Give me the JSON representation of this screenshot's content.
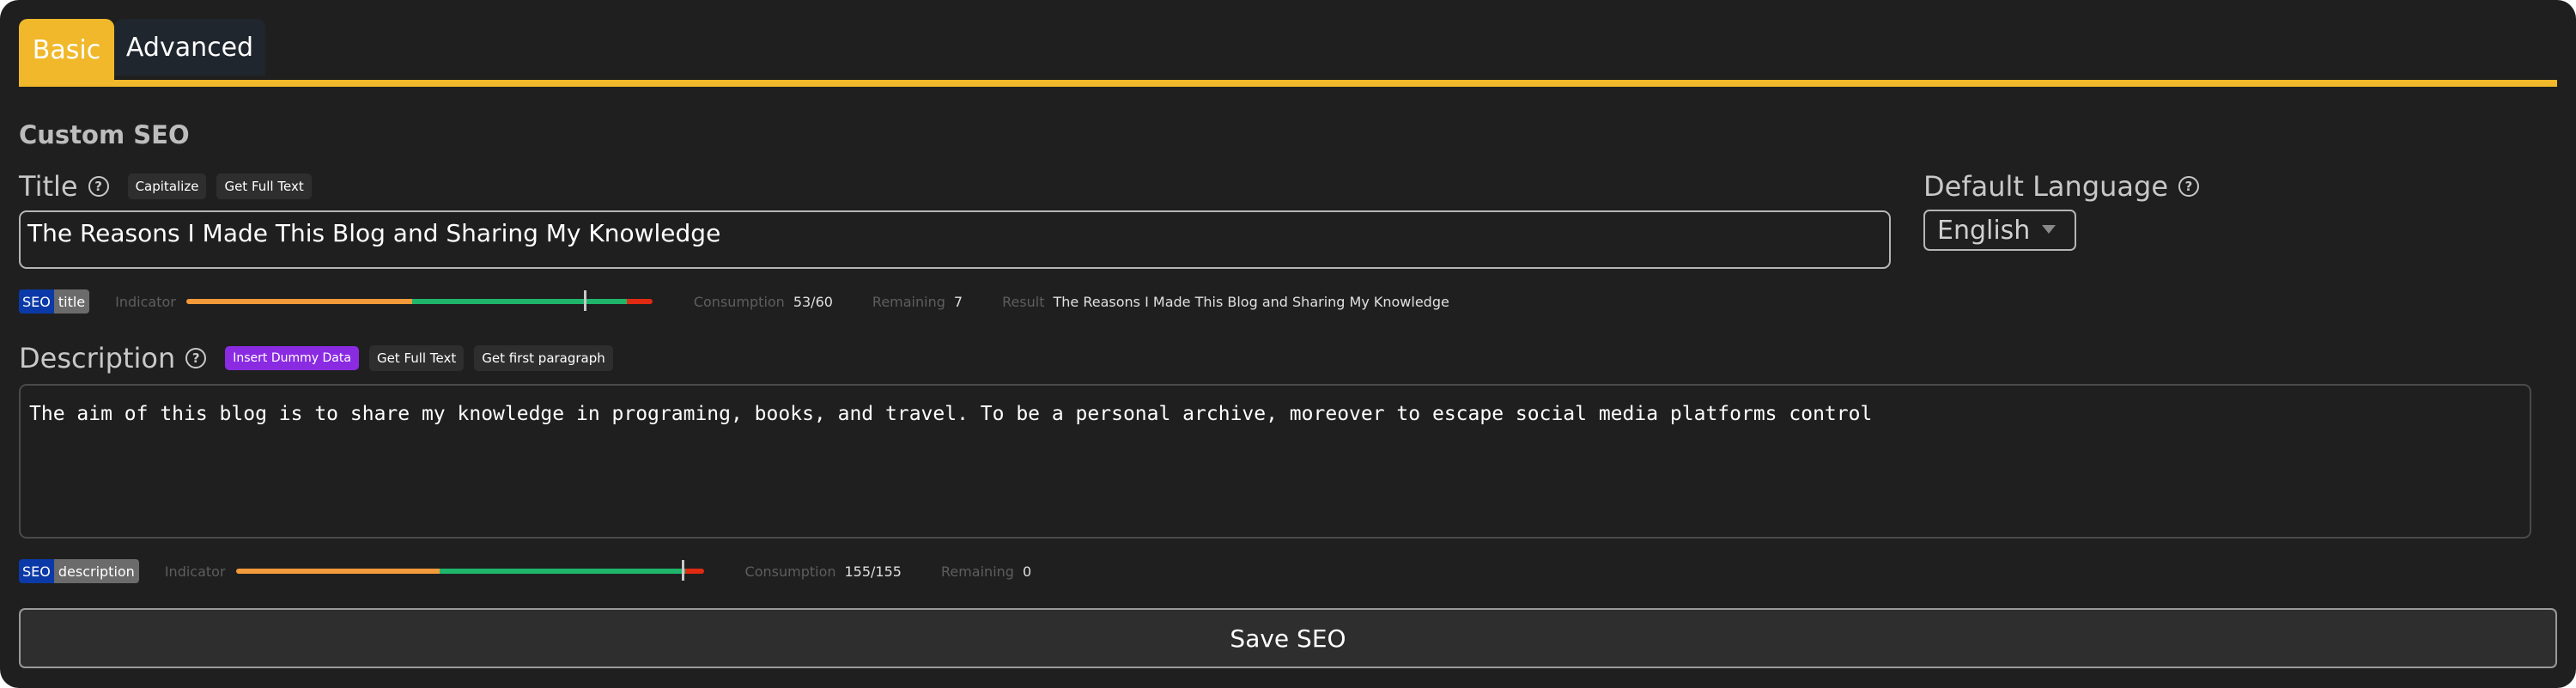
{
  "tabs": [
    {
      "label": "Basic",
      "active": true
    },
    {
      "label": "Advanced",
      "active": false
    }
  ],
  "section_title": "Custom SEO",
  "title_field": {
    "label": "Title",
    "help_icon": "question-circle-icon",
    "buttons": [
      "Capitalize",
      "Get Full Text"
    ],
    "value": "The Reasons I Made This Blog and Sharing My Knowledge"
  },
  "language_field": {
    "label": "Default Language",
    "help_icon": "question-circle-icon",
    "selected": "English"
  },
  "title_meter": {
    "badge_left": "SEO",
    "badge_right": "title",
    "indicator_label": "Indicator",
    "indicator_fraction": 0.853,
    "consumption_label": "Consumption",
    "consumption_value": "53/60",
    "remaining_label": "Remaining",
    "remaining_value": "7",
    "result_label": "Result",
    "result_value": "The Reasons I Made This Blog and Sharing My Knowledge"
  },
  "description_field": {
    "label": "Description",
    "help_icon": "question-circle-icon",
    "buttons": [
      "Insert Dummy Data",
      "Get Full Text",
      "Get first paragraph"
    ],
    "value": "The aim of this blog is to share my knowledge in programing, books, and travel. To be a personal archive, moreover to escape social media platforms control"
  },
  "description_meter": {
    "badge_left": "SEO",
    "badge_right": "description",
    "indicator_label": "Indicator",
    "indicator_fraction": 0.954,
    "consumption_label": "Consumption",
    "consumption_value": "155/155",
    "remaining_label": "Remaining",
    "remaining_value": "0"
  },
  "colors": {
    "accent": "#f0b82a",
    "bar_orange": "#f39a3a",
    "bar_green": "#1fb56b",
    "bar_red": "#e02a12",
    "purple_button": "#8a2be2",
    "seo_badge_blue": "#0b3aa8"
  },
  "save_button": "Save SEO"
}
